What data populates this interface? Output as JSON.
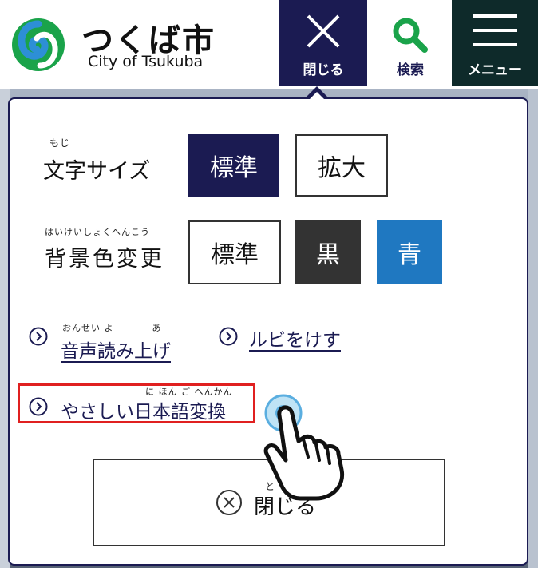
{
  "header": {
    "logo_jp": "つくば市",
    "logo_en": "City of Tsukuba",
    "close_label": "閉じる",
    "search_label": "検索",
    "menu_label": "メニュー"
  },
  "panel": {
    "font_size": {
      "ruby": "もじ",
      "label": "文字サイズ",
      "options": [
        "標準",
        "拡大"
      ],
      "selected": "標準"
    },
    "background": {
      "ruby": "はいけいしょくへんこう",
      "label": "背景色変更",
      "options": [
        "標準",
        "黒",
        "青"
      ]
    },
    "links": {
      "read_aloud_ruby": "おんせい よ　　　　あ",
      "read_aloud": "音声読み上げ",
      "remove_ruby": "ルビをけす",
      "easy_japanese_ruby": "に ほん ご へんかん",
      "easy_japanese": "やさしい日本語変換"
    },
    "close_ruby": "と",
    "close_label": "閉じる"
  },
  "colors": {
    "navy": "#1b1b52",
    "blue": "#1f78c1",
    "black_option": "#333333",
    "highlight": "#e02020"
  }
}
